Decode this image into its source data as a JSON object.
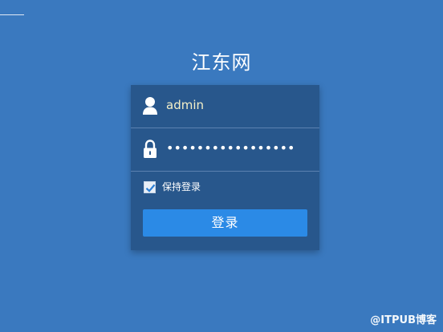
{
  "header": {
    "title": "江东网"
  },
  "login_form": {
    "username_value": "admin",
    "password_masked": "•••••••••••••••••",
    "remember_label": "保持登录",
    "remember_checked": true,
    "submit_label": "登录",
    "icons": {
      "username": "user-icon",
      "password": "lock-icon",
      "remember": "checkmark-icon"
    }
  },
  "watermark": {
    "text": "@ITPUB博客"
  },
  "colors": {
    "background": "#3a79bf",
    "panel": "#28578c",
    "button": "#2b8ae6",
    "username_text": "#f4f0c8"
  }
}
